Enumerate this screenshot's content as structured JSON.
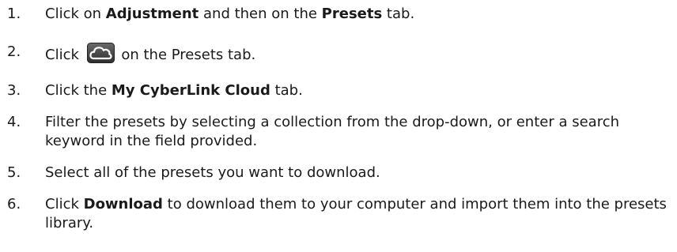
{
  "steps": [
    {
      "number": "1.",
      "parts": [
        "Click on ",
        "Adjustment",
        " and then on the ",
        "Presets",
        " tab."
      ]
    },
    {
      "number": "2.",
      "parts": [
        "Click ",
        " on the Presets tab."
      ],
      "icon": "cloud-icon"
    },
    {
      "number": "3.",
      "parts": [
        "Click the ",
        "My CyberLink Cloud",
        " tab."
      ]
    },
    {
      "number": "4.",
      "parts": [
        "Filter the presets by selecting a collection from the drop-down, or enter a search keyword in the field provided."
      ]
    },
    {
      "number": "5.",
      "parts": [
        "Select all of the presets you want to download."
      ]
    },
    {
      "number": "6.",
      "parts": [
        "Click ",
        "Download",
        " to download them to your computer and import them into the presets library."
      ]
    }
  ],
  "colors": {
    "text": "#1a1a1a",
    "icon_background": "#4a4a4a",
    "icon_cloud": "#ffffff"
  }
}
